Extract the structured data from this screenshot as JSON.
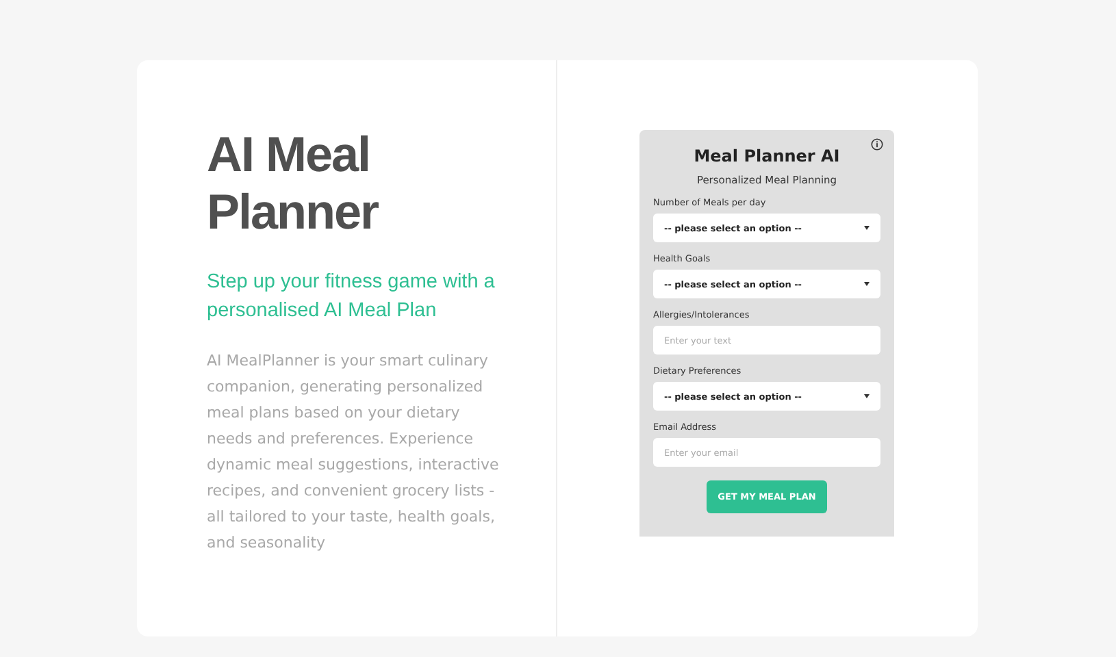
{
  "hero": {
    "title": "AI Meal Planner",
    "tagline": "Step up your fitness game with a personalised AI Meal Plan",
    "description": "AI MealPlanner is your smart culinary companion, generating personalized meal plans based on your dietary needs and preferences. Experience dynamic meal suggestions, interactive recipes, and convenient grocery lists - all tailored to your taste, health goals, and seasonality"
  },
  "form": {
    "title": "Meal Planner AI",
    "subtitle": "Personalized Meal Planning",
    "fields": [
      {
        "kind": "select",
        "label": "Number of Meals per day",
        "value": "-- please select an option --"
      },
      {
        "kind": "select",
        "label": "Health Goals",
        "value": "-- please select an option --"
      },
      {
        "kind": "text",
        "label": "Allergies/Intolerances",
        "placeholder": "Enter your text"
      },
      {
        "kind": "select",
        "label": "Dietary Preferences",
        "value": "-- please select an option --"
      },
      {
        "kind": "text",
        "label": "Email Address",
        "placeholder": "Enter your email"
      }
    ],
    "submit": "GET MY MEAL PLAN"
  }
}
